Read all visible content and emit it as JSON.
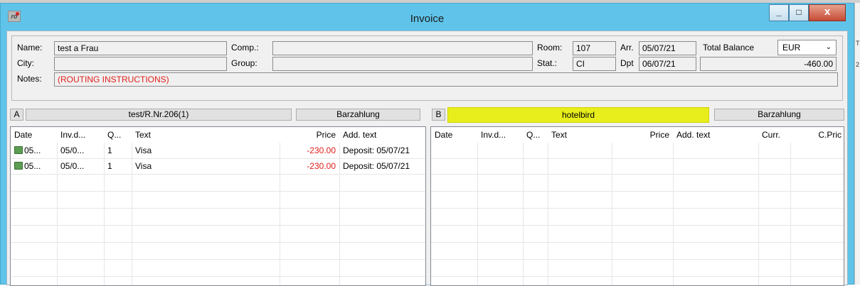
{
  "window": {
    "title": "Invoice",
    "icon_text": "ro",
    "close_symbol": "x",
    "min_symbol": "_",
    "max_symbol": "□"
  },
  "header": {
    "name_label": "Name:",
    "name_value": "test a Frau",
    "city_label": "City:",
    "city_value": "",
    "notes_label": "Notes:",
    "notes_value": "(ROUTING INSTRUCTIONS)",
    "comp_label": "Comp.:",
    "comp_value": "",
    "group_label": "Group:",
    "group_value": "",
    "room_label": "Room:",
    "room_value": "107",
    "stat_label": "Stat.:",
    "stat_value": "CI",
    "arr_label": "Arr.",
    "arr_value": "05/07/21",
    "dpt_label": "Dpt",
    "dpt_value": "06/07/21",
    "total_balance_label": "Total Balance",
    "currency": "EUR",
    "balance_value": "-460.00"
  },
  "pane_a": {
    "letter": "A",
    "name": "test/R.Nr.206(1)",
    "payment": "Barzahlung",
    "columns": [
      "Date",
      "Inv.d...",
      "Q...",
      "Text",
      "Price",
      "Add. text"
    ],
    "rows": [
      {
        "date": "05...",
        "invd": "05/0...",
        "qty": "1",
        "text": "Visa",
        "price": "-230.00",
        "add": "Deposit: 05/07/21"
      },
      {
        "date": "05...",
        "invd": "05/0...",
        "qty": "1",
        "text": "Visa",
        "price": "-230.00",
        "add": "Deposit: 05/07/21"
      }
    ]
  },
  "pane_b": {
    "letter": "B",
    "name": "hotelbird",
    "payment": "Barzahlung",
    "columns": [
      "Date",
      "Inv.d...",
      "Q...",
      "Text",
      "Price",
      "Add. text",
      "Curr.",
      "C.Pric"
    ]
  },
  "colors": {
    "titlebar": "#60c4ea",
    "negative": "#e0201c",
    "highlight": "#e7ee1c"
  }
}
